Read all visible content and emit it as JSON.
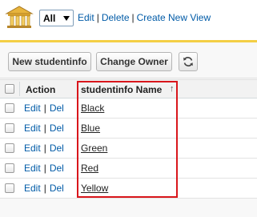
{
  "header": {
    "view_selected": "All",
    "links": {
      "edit": "Edit",
      "delete": "Delete",
      "create_new_view": "Create New View"
    },
    "separator": "|"
  },
  "toolbar": {
    "new_button": "New studentinfo",
    "change_owner_button": "Change Owner",
    "refresh_icon": "refresh-icon"
  },
  "table": {
    "columns": {
      "action": "Action",
      "name": "studentinfo Name",
      "sort_indicator": "↑"
    },
    "rows": [
      {
        "edit": "Edit",
        "del": "Del",
        "name": "Black"
      },
      {
        "edit": "Edit",
        "del": "Del",
        "name": "Blue"
      },
      {
        "edit": "Edit",
        "del": "Del",
        "name": "Green"
      },
      {
        "edit": "Edit",
        "del": "Del",
        "name": "Red"
      },
      {
        "edit": "Edit",
        "del": "Del",
        "name": "Yellow"
      }
    ],
    "action_separator": "|"
  },
  "colors": {
    "accent_bar": "#f3cf45",
    "link": "#015ba7",
    "highlight_box": "#d9161c"
  }
}
